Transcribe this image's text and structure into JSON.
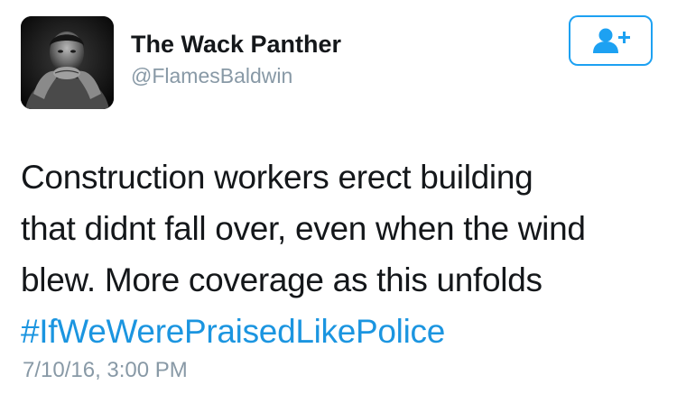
{
  "user": {
    "display_name": "The Wack Panther",
    "handle": "@FlamesBaldwin",
    "avatar_icon": "profile-photo"
  },
  "follow_button": {
    "icon": "add-user-icon",
    "accent_color": "#1da1f2"
  },
  "tweet": {
    "lines": [
      "Construction workers erect building",
      "that didnt fall over, even when the wind",
      "blew. More coverage as this unfolds"
    ],
    "hashtag": "#IfWeWerePraisedLikePolice",
    "hashtag_color": "#1b95e0"
  },
  "timestamp": "7/10/16, 3:00 PM"
}
